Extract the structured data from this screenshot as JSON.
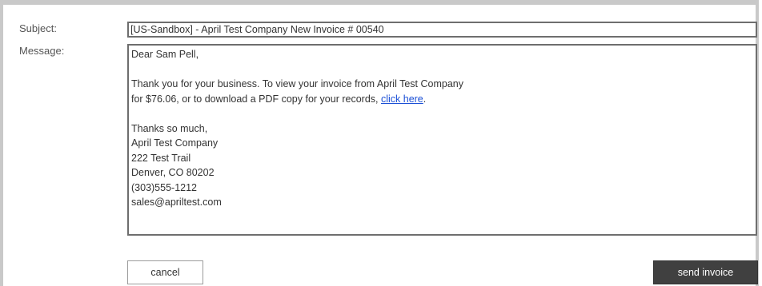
{
  "form": {
    "subject_label": "Subject:",
    "message_label": "Message:",
    "subject_value": "[US-Sandbox] - April Test Company New Invoice # 00540"
  },
  "message": {
    "greeting": "Dear Sam Pell,",
    "body_line1": "Thank you for your business. To view your invoice from April Test Company",
    "body_line2": "for $76.06, or to download a PDF copy for your records, ",
    "link_text": "click here",
    "body_line2_end": ".",
    "closing": "Thanks so much,",
    "company": "April Test Company",
    "street": "222 Test Trail",
    "city": "Denver, CO 80202",
    "phone": "(303)555-1212",
    "email": "sales@apriltest.com"
  },
  "buttons": {
    "cancel_label": "cancel",
    "send_label": "send invoice"
  },
  "colors": {
    "link": "#1a4fd6",
    "send_button_bg": "#404040",
    "frame_border": "#c9c9c9"
  }
}
